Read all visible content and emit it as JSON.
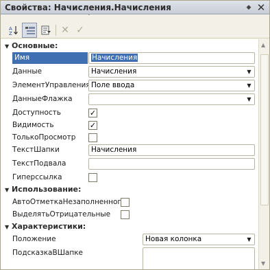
{
  "window": {
    "title": "Свойства: Начисления.Начисления"
  },
  "toolbar": {
    "sort_icon": "sort-az-icon",
    "categories_icon": "categories-icon",
    "filter_icon": "filter-icon",
    "delete_glyph": "✕",
    "check_glyph": "✓"
  },
  "sections": {
    "basic": "Основные:",
    "usage": "Использование:",
    "characteristics": "Характеристики:"
  },
  "props": {
    "name": {
      "label": "Имя",
      "value": "Начисления"
    },
    "data": {
      "label": "Данные",
      "value": "Начисления"
    },
    "control": {
      "label": "ЭлементУправления",
      "value": "Поле ввода"
    },
    "flag_data": {
      "label": "ДанныеФлажка",
      "value": ""
    },
    "availability": {
      "label": "Доступность",
      "checked": true
    },
    "visibility": {
      "label": "Видимость",
      "checked": true
    },
    "readonly": {
      "label": "ТолькоПросмотр",
      "checked": false
    },
    "header_text": {
      "label": "ТекстШапки",
      "value": "Начисления"
    },
    "footer_text": {
      "label": "ТекстПодвала",
      "value": ""
    },
    "hyperlink": {
      "label": "Гиперссылка",
      "checked": false
    },
    "auto_mark": {
      "label": "АвтоОтметкаНезаполненного",
      "checked": false
    },
    "highlight_neg": {
      "label": "ВыделятьОтрицательные",
      "checked": false
    },
    "position": {
      "label": "Положение",
      "value": "Новая колонка"
    },
    "header_hint": {
      "label": "ПодсказкаВШапке",
      "value": ""
    }
  },
  "colors": {
    "selection": "#3f6fb1",
    "panel_bg": "#f3f1e7",
    "title_bg": "#c7ccd6"
  }
}
